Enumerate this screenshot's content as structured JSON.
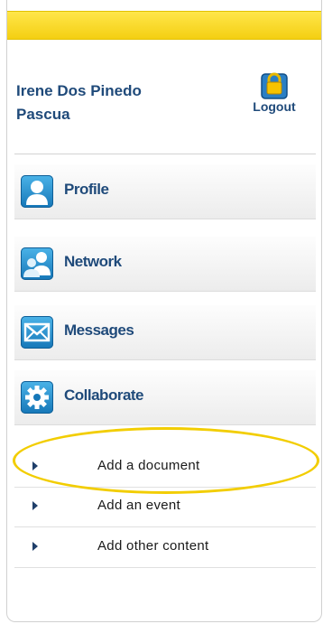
{
  "user": {
    "name_line1": "Irene Dos Pinedo",
    "name_line2": "Pascua"
  },
  "logout": {
    "label": "Logout",
    "icon": "lock-icon"
  },
  "nav": [
    {
      "label": "Profile",
      "icon": "person-icon"
    },
    {
      "label": "Network",
      "icon": "people-icon"
    },
    {
      "label": "Messages",
      "icon": "envelope-icon"
    },
    {
      "label": "Collaborate",
      "icon": "gear-icon"
    }
  ],
  "collaborate_menu": [
    {
      "label": "Add a document"
    },
    {
      "label": "Add an event"
    },
    {
      "label": "Add other content"
    }
  ],
  "colors": {
    "accent_yellow": "#f4cf12",
    "text_blue": "#1f4a7a",
    "icon_blue": "#1677b8"
  }
}
